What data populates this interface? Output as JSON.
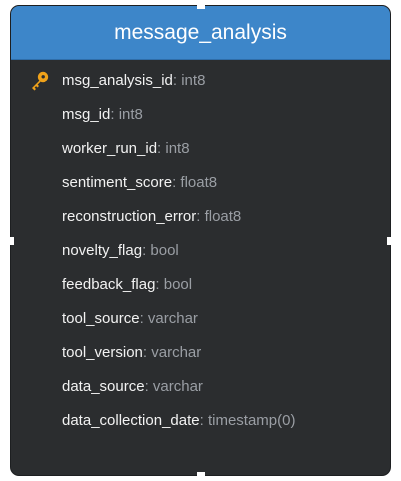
{
  "table": {
    "name": "message_analysis",
    "columns": [
      {
        "name": "msg_analysis_id",
        "type": ": int8",
        "primary_key": true
      },
      {
        "name": "msg_id",
        "type": ": int8"
      },
      {
        "name": "worker_run_id",
        "type": ": int8"
      },
      {
        "name": "sentiment_score",
        "type": ": float8"
      },
      {
        "name": "reconstruction_error",
        "type": ": float8"
      },
      {
        "name": "novelty_flag",
        "type": ": bool"
      },
      {
        "name": "feedback_flag",
        "type": ": bool"
      },
      {
        "name": "tool_source",
        "type": ": varchar"
      },
      {
        "name": "tool_version",
        "type": ": varchar"
      },
      {
        "name": "data_source",
        "type": ": varchar"
      },
      {
        "name": "data_collection_date",
        "type": ": timestamp(0)"
      }
    ]
  },
  "colors": {
    "header_bg": "#3d86c9",
    "body_bg": "#2b2d2f",
    "column_name": "#f2f2f2",
    "column_type": "#9a9ea4",
    "key_icon": "#f0a21a"
  },
  "icons": {
    "primary_key": "key-icon"
  }
}
